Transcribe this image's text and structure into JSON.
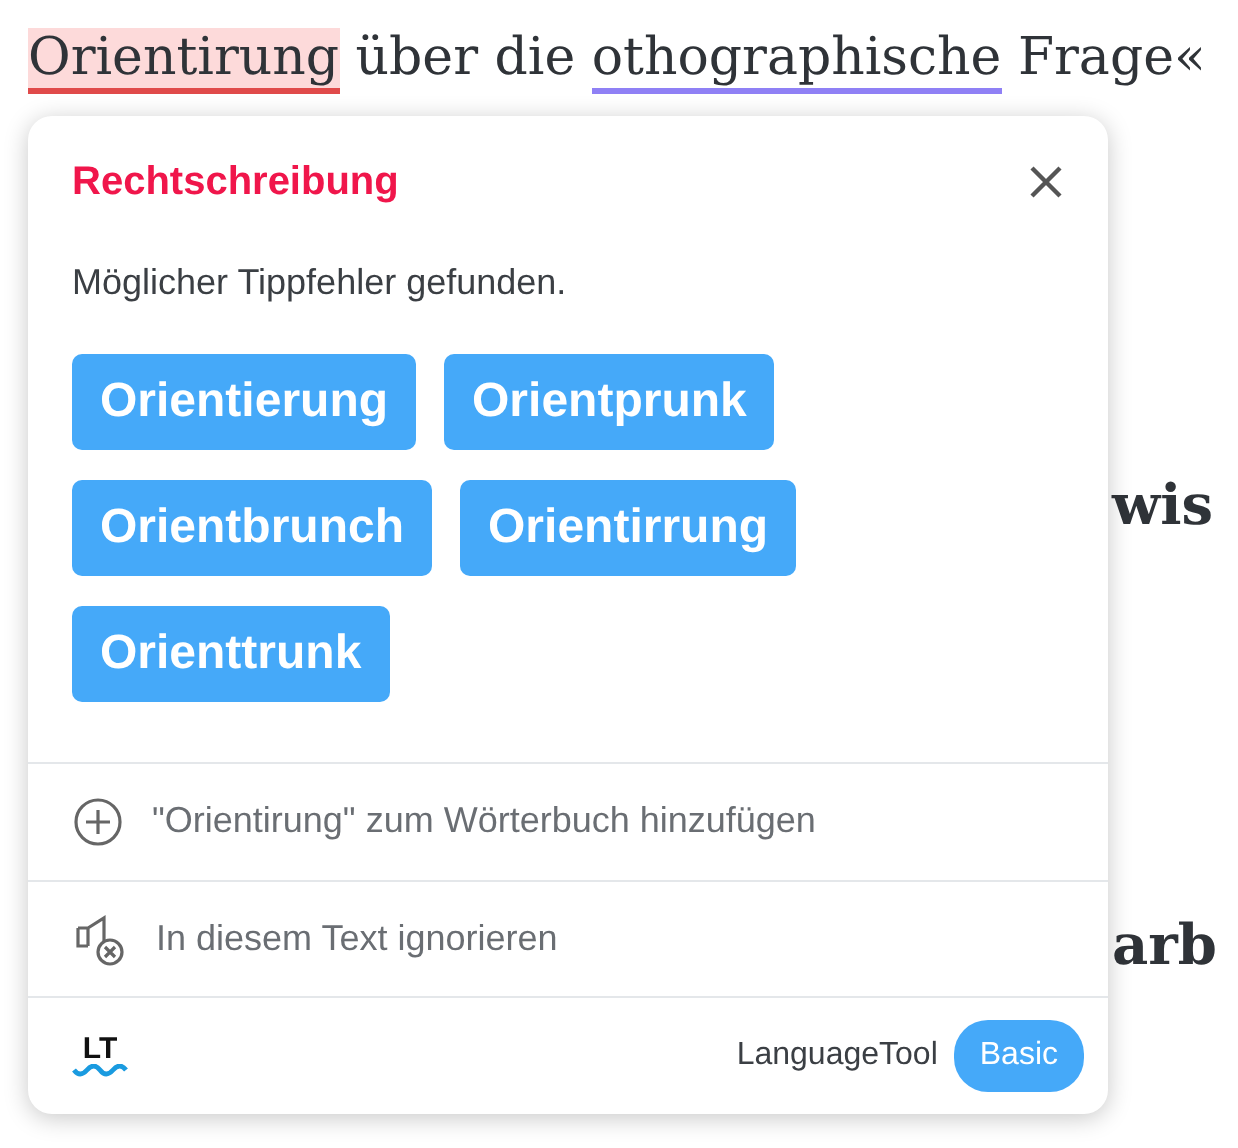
{
  "document": {
    "first_line": [
      {
        "text": "Orientirung",
        "kind": "spelling"
      },
      {
        "text": " über die ",
        "kind": "plain"
      },
      {
        "text": "othographische",
        "kind": "style"
      },
      {
        "text": " Frage«",
        "kind": "plain"
      }
    ],
    "heading_fragments": [
      "wis",
      "arb"
    ]
  },
  "popup": {
    "category": "Rechtschreibung",
    "message": "Möglicher Tippfehler gefunden.",
    "suggestions": [
      "Orientierung",
      "Orientprunk",
      "Orientbrunch",
      "Orientirrung",
      "Orienttrunk"
    ],
    "actions": [
      {
        "kind": "add",
        "label": "\"Orientirung\" zum Wörterbuch hinzufügen"
      },
      {
        "kind": "ignore",
        "label": "In diesem Text ignorieren"
      }
    ],
    "footer": {
      "logo": "LT",
      "brand": "LanguageTool",
      "plan": "Basic"
    }
  }
}
